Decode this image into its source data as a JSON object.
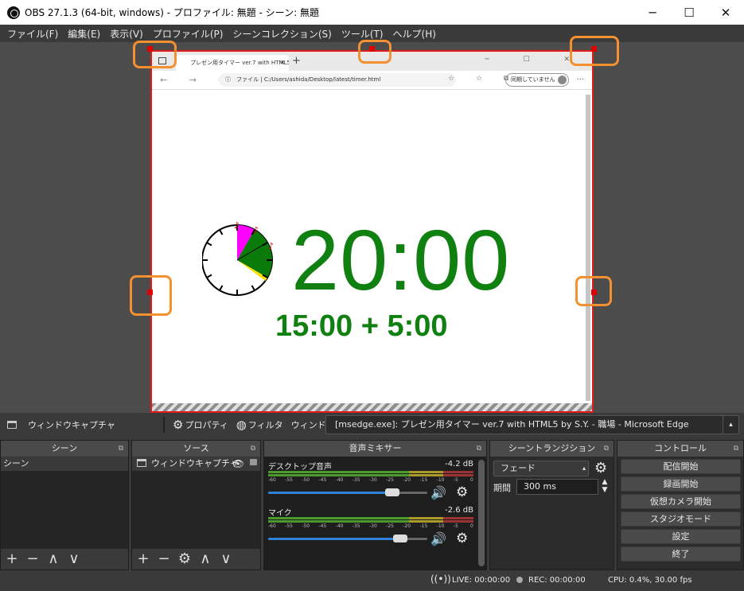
{
  "window": {
    "title": "OBS 27.1.3 (64-bit, windows) - プロファイル: 無題 - シーン: 無題",
    "minimize": "─",
    "maximize": "☐",
    "close": "✕"
  },
  "menu": [
    "ファイル(F)",
    "編集(E)",
    "表示(V)",
    "プロファイル(P)",
    "シーンコレクション(S)",
    "ツール(T)",
    "ヘルプ(H)"
  ],
  "browser": {
    "tab_title": "プレゼン用タイマー ver.7 with HTML5",
    "tab_close": "✕",
    "new_tab": "+",
    "nav": "← → ⟳",
    "url_prefix": "ファイル",
    "url": "C:/Users/ashida/Desktop/latest/timer.html",
    "profile_label": "同期していません",
    "more": "···",
    "window_controls": "─ ☐ ✕",
    "tools": "☆ ☆ ⧉"
  },
  "timer": {
    "main": "20:00",
    "sub": "15:00 + 5:00",
    "bell": "♪"
  },
  "context_bar": {
    "source_name": "ウィンドウキャプチャ",
    "properties": "プロパティ",
    "filters": "フィルタ",
    "window_label": "ウィンドウ",
    "window_value": "[msedge.exe]: プレゼン用タイマー ver.7 with HTML5 by S.Y. - 職場 - Microsoft Edge"
  },
  "scenes": {
    "header": "シーン",
    "items": [
      "シーン"
    ]
  },
  "sources": {
    "header": "ソース",
    "items": [
      "ウィンドウキャプチャ"
    ]
  },
  "mixer": {
    "header": "音声ミキサー",
    "tracks": [
      {
        "name": "デスクトップ音声",
        "db": "-4.2 dB",
        "volume": 0.78
      },
      {
        "name": "マイク",
        "db": "-2.6 dB",
        "volume": 0.83
      }
    ],
    "scale": [
      "-60",
      "-55",
      "-50",
      "-45",
      "-40",
      "-35",
      "-30",
      "-25",
      "-20",
      "-15",
      "-10",
      "-5",
      "0"
    ]
  },
  "transitions": {
    "header": "シーントランジション",
    "selected": "フェード",
    "duration_label": "期間",
    "duration_value": "300 ms"
  },
  "controls": {
    "header": "コントロール",
    "buttons": [
      "配信開始",
      "録画開始",
      "仮想カメラ開始",
      "スタジオモード",
      "設定",
      "終了"
    ]
  },
  "dock_tools": {
    "add": "+",
    "remove": "−",
    "up": "∧",
    "down": "∨",
    "settings": "⚙"
  },
  "status": {
    "live": "LIVE: 00:00:00",
    "rec": "REC: 00:00:00",
    "cpu": "CPU: 0.4%, 30.00 fps"
  },
  "colors": {
    "timer_green": "#108010",
    "capture_border": "#e21b1b",
    "annotation_ring": "#f39030",
    "pie_magenta": "#ff00ff",
    "pie_green": "#0a7a0a",
    "pie_yellow": "#ffe000"
  }
}
